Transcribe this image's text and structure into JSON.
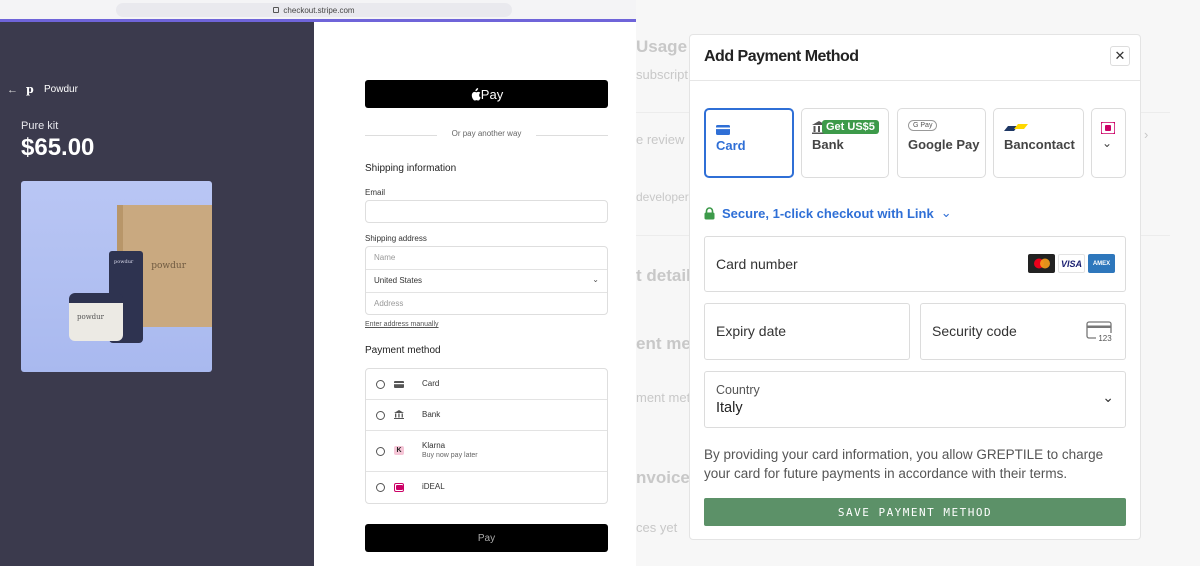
{
  "browser": {
    "url": "checkout.stripe.com"
  },
  "store": {
    "brand_mark": "p",
    "brand_name": "Powdur",
    "product_name": "Pure kit",
    "price": "$65.00",
    "image_labels": {
      "box": "powdur",
      "tube": "powdur",
      "jar": "powdur"
    }
  },
  "checkout": {
    "apple_pay_label": "Pay",
    "divider_text": "Or pay another way",
    "shipping_title": "Shipping information",
    "email_label": "Email",
    "email_value": "",
    "shipping_address_label": "Shipping address",
    "name_placeholder": "Name",
    "country_value": "United States",
    "address_placeholder": "Address",
    "manual_link": "Enter address manually",
    "payment_title": "Payment method",
    "payment_options": [
      {
        "label": "Card",
        "sub": "",
        "icon": "card-icon"
      },
      {
        "label": "Bank",
        "sub": "",
        "icon": "bank-icon"
      },
      {
        "label": "Klarna",
        "sub": "Buy now pay later",
        "icon": "klarna-icon"
      },
      {
        "label": "iDEAL",
        "sub": "",
        "icon": "ideal-icon"
      }
    ],
    "pay_button": "Pay"
  },
  "background_page": {
    "fragments": [
      "Usage",
      "subscript",
      "e review",
      "developers",
      "t detail",
      "ent met",
      "ment meth",
      "nvoices",
      "ces yet"
    ]
  },
  "modal": {
    "title": "Add Payment Method",
    "close_icon": "close-icon",
    "tabs": [
      {
        "label": "Card",
        "selected": true,
        "icon": "card-icon"
      },
      {
        "label": "Bank",
        "selected": false,
        "icon": "bank-icon",
        "badge": "Get US$5"
      },
      {
        "label": "Google Pay",
        "selected": false,
        "icon": "google-pay-icon",
        "icon_text": "G Pay"
      },
      {
        "label": "Bancontact",
        "selected": false,
        "icon": "bancontact-icon"
      },
      {
        "label": "",
        "selected": false,
        "icon": "ideal-icon",
        "more": "chevron-down-icon"
      }
    ],
    "link_text": "Secure, 1-click checkout with Link",
    "card_number_label": "Card number",
    "card_brands": [
      "mastercard",
      "VISA",
      "AMEX"
    ],
    "expiry_label": "Expiry date",
    "security_label": "Security code",
    "security_icon_text": "123",
    "country_label": "Country",
    "country_value": "Italy",
    "terms": "By providing your card information, you allow GREPTILE to charge your card for future payments in accordance with their terms.",
    "save_button": "SAVE PAYMENT METHOD"
  },
  "colors": {
    "accent_blue": "#2f6fd6",
    "save_green": "#5c9168",
    "badge_green": "#3d9a4a",
    "checkout_dark": "#3b3a4d",
    "progress_purple": "#6f64d9"
  }
}
